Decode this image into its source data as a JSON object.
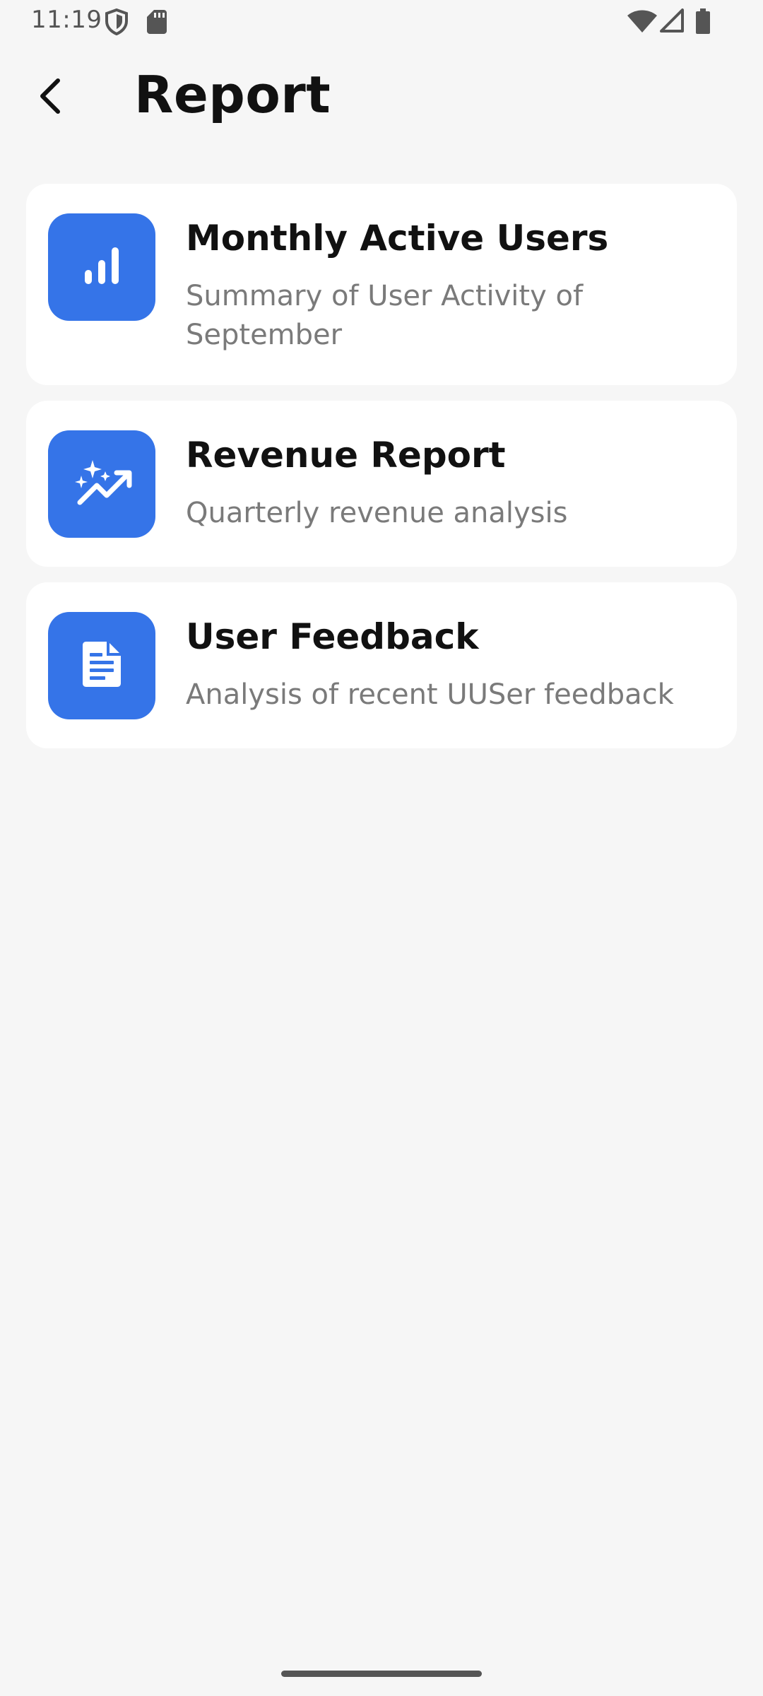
{
  "status_bar": {
    "time": "11:19",
    "icons": [
      "shield-icon",
      "sd-card-icon",
      "wifi-icon",
      "signal-icon",
      "battery-icon"
    ]
  },
  "app_bar": {
    "back_icon": "back-arrow-icon",
    "title": "Report"
  },
  "reports": [
    {
      "icon": "bar-chart-icon",
      "title": "Monthly Active Users",
      "subtitle": "Summary of User Activity of September"
    },
    {
      "icon": "trending-sparkle-icon",
      "title": "Revenue Report",
      "subtitle": "Quarterly revenue analysis"
    },
    {
      "icon": "document-icon",
      "title": "User Feedback",
      "subtitle": "Analysis of recent UUSer feedback"
    }
  ],
  "colors": {
    "background": "#f6f6f6",
    "card": "#ffffff",
    "accent": "#3574e8",
    "title_text": "#111111",
    "subtitle_text": "#7a7a7a"
  }
}
